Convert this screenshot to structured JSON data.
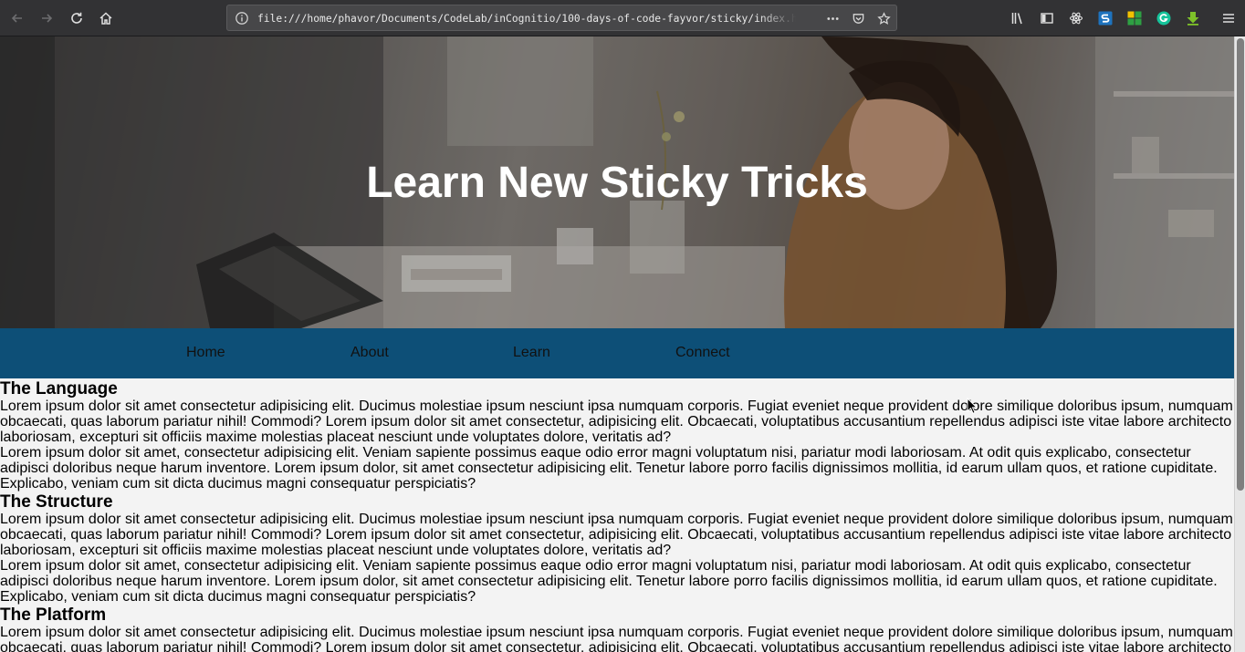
{
  "browser": {
    "url": "file:///home/phavor/Documents/CodeLab/inCognitio/100-days-of-code-fayvor/sticky/index.html",
    "icons": [
      "back-arrow-icon",
      "forward-arrow-icon",
      "reload-icon",
      "home-icon",
      "info-icon",
      "more-actions-icon",
      "pocket-icon",
      "star-icon",
      "library-icon",
      "sidebar-icon",
      "react-devtools-icon",
      "extension-s-icon",
      "extension-grid-icon",
      "grammarly-icon",
      "download-icon",
      "menu-icon"
    ]
  },
  "hero": {
    "title": "Learn New Sticky Tricks"
  },
  "nav": {
    "items": [
      "Home",
      "About",
      "Learn",
      "Connect"
    ]
  },
  "sections": [
    {
      "heading": "The Language",
      "p1": "Lorem ipsum dolor sit amet consectetur adipisicing elit. Ducimus molestiae ipsum nesciunt ipsa numquam corporis. Fugiat eveniet neque provident dolore similique doloribus ipsum, numquam obcaecati, quas laborum pariatur nihil! Commodi? Lorem ipsum dolor sit amet consectetur, adipisicing elit. Obcaecati, voluptatibus accusantium repellendus adipisci iste vitae labore architecto laboriosam, excepturi sit officiis maxime molestias placeat nesciunt unde voluptates dolore, veritatis ad?",
      "p2": "Lorem ipsum dolor sit amet, consectetur adipisicing elit. Veniam sapiente possimus eaque odio error magni voluptatum nisi, pariatur modi laboriosam. At odit quis explicabo, consectetur adipisci doloribus neque harum inventore. Lorem ipsum dolor, sit amet consectetur adipisicing elit. Tenetur labore porro facilis dignissimos mollitia, id earum ullam quos, et ratione cupiditate. Explicabo, veniam cum sit dicta ducimus magni consequatur perspiciatis?"
    },
    {
      "heading": "The Structure",
      "p1": "Lorem ipsum dolor sit amet consectetur adipisicing elit. Ducimus molestiae ipsum nesciunt ipsa numquam corporis. Fugiat eveniet neque provident dolore similique doloribus ipsum, numquam obcaecati, quas laborum pariatur nihil! Commodi? Lorem ipsum dolor sit amet consectetur, adipisicing elit. Obcaecati, voluptatibus accusantium repellendus adipisci iste vitae labore architecto laboriosam, excepturi sit officiis maxime molestias placeat nesciunt unde voluptates dolore, veritatis ad?",
      "p2": "Lorem ipsum dolor sit amet, consectetur adipisicing elit. Veniam sapiente possimus eaque odio error magni voluptatum nisi, pariatur modi laboriosam. At odit quis explicabo, consectetur adipisci doloribus neque harum inventore. Lorem ipsum dolor, sit amet consectetur adipisicing elit. Tenetur labore porro facilis dignissimos mollitia, id earum ullam quos, et ratione cupiditate. Explicabo, veniam cum sit dicta ducimus magni consequatur perspiciatis?"
    },
    {
      "heading": "The Platform",
      "p1": "Lorem ipsum dolor sit amet consectetur adipisicing elit. Ducimus molestiae ipsum nesciunt ipsa numquam corporis. Fugiat eveniet neque provident dolore similique doloribus ipsum, numquam obcaecati, quas laborum pariatur nihil! Commodi? Lorem ipsum dolor sit amet consectetur, adipisicing elit. Obcaecati, voluptatibus accusantium repellendus adipisci iste vitae labore architecto laboriosam, excepturi sit officiis maxime molestias placeat nesciunt unde voluptates dolore, veritatis ad?"
    }
  ],
  "colors": {
    "toolbar": "#323234",
    "nav_background": "#0d4f77",
    "page_background": "#f3f3f3",
    "hero_text": "#ffffff"
  }
}
